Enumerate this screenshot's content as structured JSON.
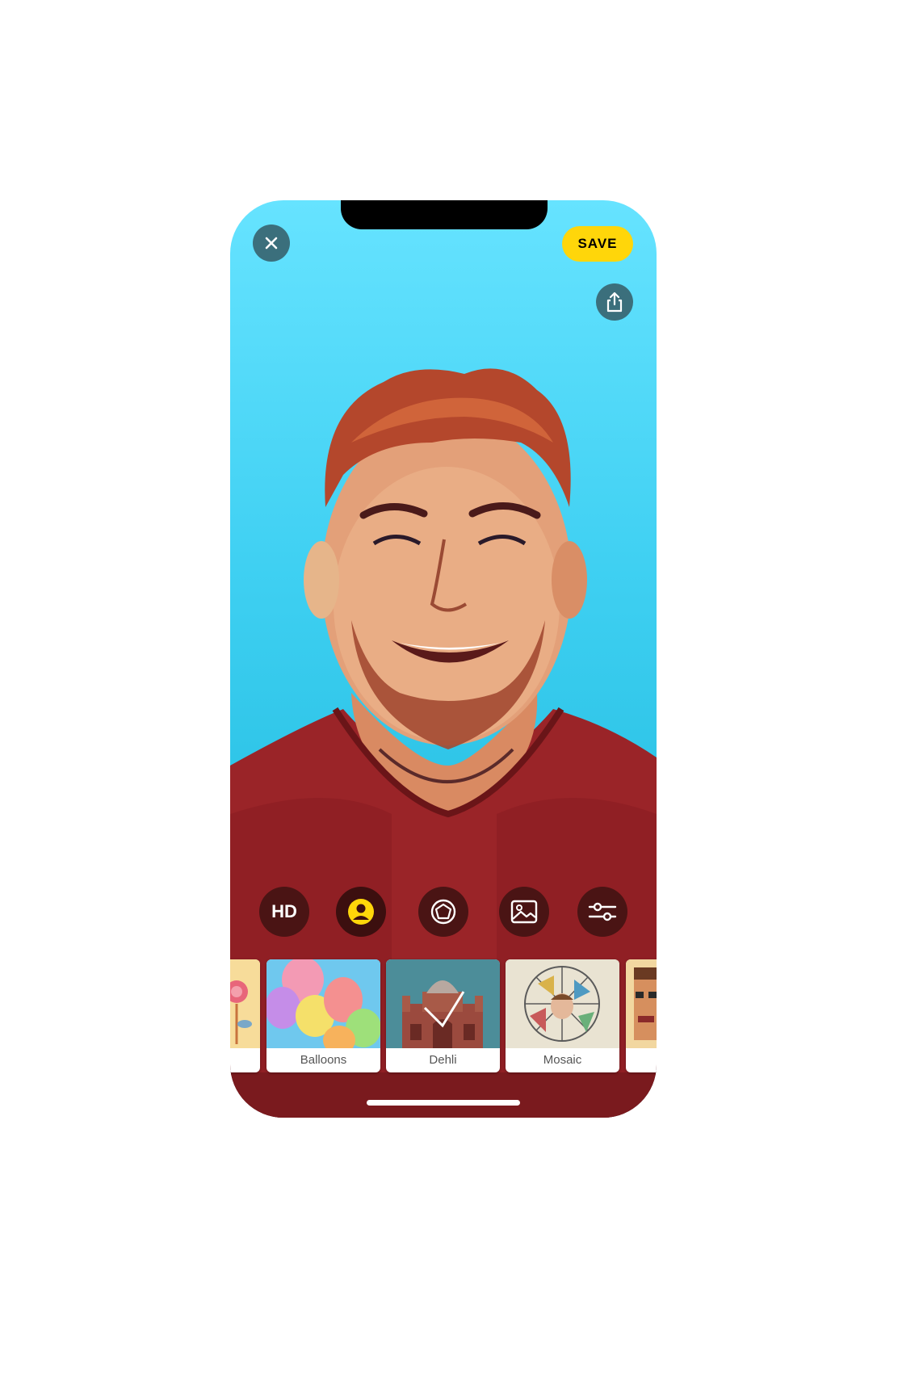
{
  "topbar": {
    "close_icon": "close-icon",
    "save_label": "SAVE",
    "share_icon": "share-icon"
  },
  "tools": [
    {
      "name": "hd",
      "label": "HD"
    },
    {
      "name": "portrait",
      "icon": "person-icon",
      "active": true
    },
    {
      "name": "effects",
      "icon": "pentagon-icon"
    },
    {
      "name": "background",
      "icon": "image-icon"
    },
    {
      "name": "adjust",
      "icon": "sliders-icon"
    }
  ],
  "styles": [
    {
      "label": "",
      "thumb": "flower"
    },
    {
      "label": "Balloons",
      "thumb": "balloons"
    },
    {
      "label": "Dehli",
      "thumb": "dehli",
      "selected": true
    },
    {
      "label": "Mosaic",
      "thumb": "mosaic"
    },
    {
      "label": "",
      "thumb": "pixel-face"
    }
  ],
  "colors": {
    "accent": "#ffd60a",
    "sky_top": "#66e3ff",
    "sky_bottom": "#1fb6da",
    "sweater": "#8a1f22"
  }
}
